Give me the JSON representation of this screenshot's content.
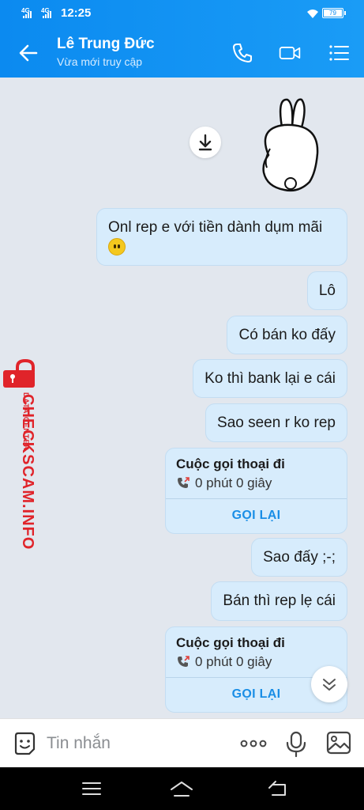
{
  "status_bar": {
    "network_1": "4G",
    "network_2": "4G",
    "time": "12:25",
    "battery": "79"
  },
  "header": {
    "contact_name": "Lê Trung Đức",
    "status": "Vừa mới truy cập",
    "icons": [
      "back-arrow-icon",
      "phone-icon",
      "video-call-icon",
      "menu-list-icon"
    ]
  },
  "messages": {
    "m1": "Onl rep e với tiền dành dụm mãi",
    "m2": "Lô",
    "m3": "Có bán ko đấy",
    "m4": "Ko thì bank lại e cái",
    "m5": "Sao seen r ko rep",
    "call1": {
      "title": "Cuộc gọi thoại đi",
      "duration": "0 phút 0 giây",
      "action": "GỌI LẠI"
    },
    "m6": "Sao đấy ;-;",
    "m7": "Bán thì rep lẹ cái",
    "call2": {
      "title": "Cuộc gọi thoại đi",
      "duration": "0 phút 0 giây",
      "action": "GỌI LẠI"
    }
  },
  "watermark": {
    "main": "CHECKSCAM.INFO",
    "sub": "DATA CENTER"
  },
  "input": {
    "placeholder": "Tin nhắn"
  },
  "colors": {
    "header": "#0b8af0",
    "bubble": "#d7ecfc",
    "chat_bg": "#e2e7ee",
    "accent": "#1a8ee6",
    "watermark": "#e0242a"
  }
}
